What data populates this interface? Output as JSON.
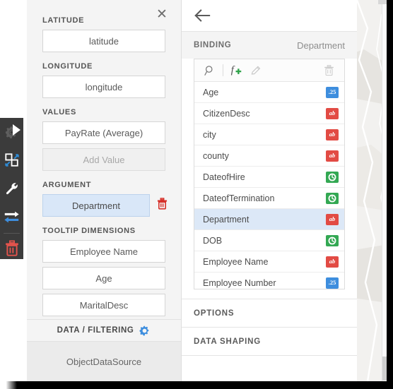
{
  "theme": {
    "toolbar_bg": "#3b3b3b",
    "panel_bg": "#f4f4f4",
    "accent_blue": "#3e8ede",
    "accent_red": "#e24b44",
    "accent_green": "#33a853",
    "selection_blue": "#dce8f7"
  },
  "dark_toolbar": {
    "items": [
      {
        "name": "options-gear",
        "icon": "gear-icon"
      },
      {
        "name": "swap-widget",
        "icon": "swap-squares-icon"
      },
      {
        "name": "edit-tools",
        "icon": "wrench-icon"
      },
      {
        "name": "transpose",
        "icon": "two-way-arrows-icon"
      },
      {
        "name": "delete-widget",
        "icon": "trash-icon"
      }
    ]
  },
  "left_panel": {
    "close_label": "✕",
    "sections": [
      {
        "label": "LATITUDE",
        "name": "latitude"
      },
      {
        "label": "LONGITUDE",
        "name": "longitude"
      },
      {
        "label": "VALUES",
        "name": "values"
      },
      {
        "label": "ARGUMENT",
        "name": "argument"
      },
      {
        "label": "TOOLTIP DIMENSIONS",
        "name": "tooltip-dimensions"
      }
    ],
    "latitude_field": "latitude",
    "longitude_field": "longitude",
    "values_field": "PayRate (Average)",
    "add_value_label": "Add Value",
    "argument_field": "Department",
    "tooltip_dimensions": [
      "Employee Name",
      "Age",
      "MaritalDesc"
    ],
    "data_filtering_label": "DATA / FILTERING",
    "data_source_label": "ObjectDataSource"
  },
  "right_panel": {
    "back_icon": "back-arrow-icon",
    "binding_label": "BINDING",
    "binding_value": "Department",
    "toolbar": [
      {
        "name": "search-icon",
        "label": "Search",
        "enabled": true
      },
      {
        "name": "add-calculated-field-icon",
        "label": "Add Calculated Field",
        "enabled": true
      },
      {
        "name": "edit-pencil-icon",
        "label": "Edit",
        "enabled": false
      },
      {
        "name": "delete-trash-icon",
        "label": "Delete",
        "enabled": false
      }
    ],
    "fields": [
      {
        "name": "Age",
        "type": "num",
        "badge": ".25",
        "selected": false
      },
      {
        "name": "CitizenDesc",
        "type": "txt",
        "badge": "ab",
        "selected": false
      },
      {
        "name": "city",
        "type": "txt",
        "badge": "ab",
        "selected": false
      },
      {
        "name": "county",
        "type": "txt",
        "badge": "ab",
        "selected": false
      },
      {
        "name": "DateofHire",
        "type": "date",
        "badge": "",
        "selected": false
      },
      {
        "name": "DateofTermination",
        "type": "date",
        "badge": "",
        "selected": false
      },
      {
        "name": "Department",
        "type": "txt",
        "badge": "ab",
        "selected": true
      },
      {
        "name": "DOB",
        "type": "date",
        "badge": "",
        "selected": false
      },
      {
        "name": "Employee Name",
        "type": "txt",
        "badge": "ab",
        "selected": false
      },
      {
        "name": "Employee Number",
        "type": "num",
        "badge": ".25",
        "selected": false
      }
    ],
    "sections": [
      {
        "label": "OPTIONS",
        "name": "options"
      },
      {
        "label": "DATA SHAPING",
        "name": "data-shaping"
      }
    ]
  }
}
